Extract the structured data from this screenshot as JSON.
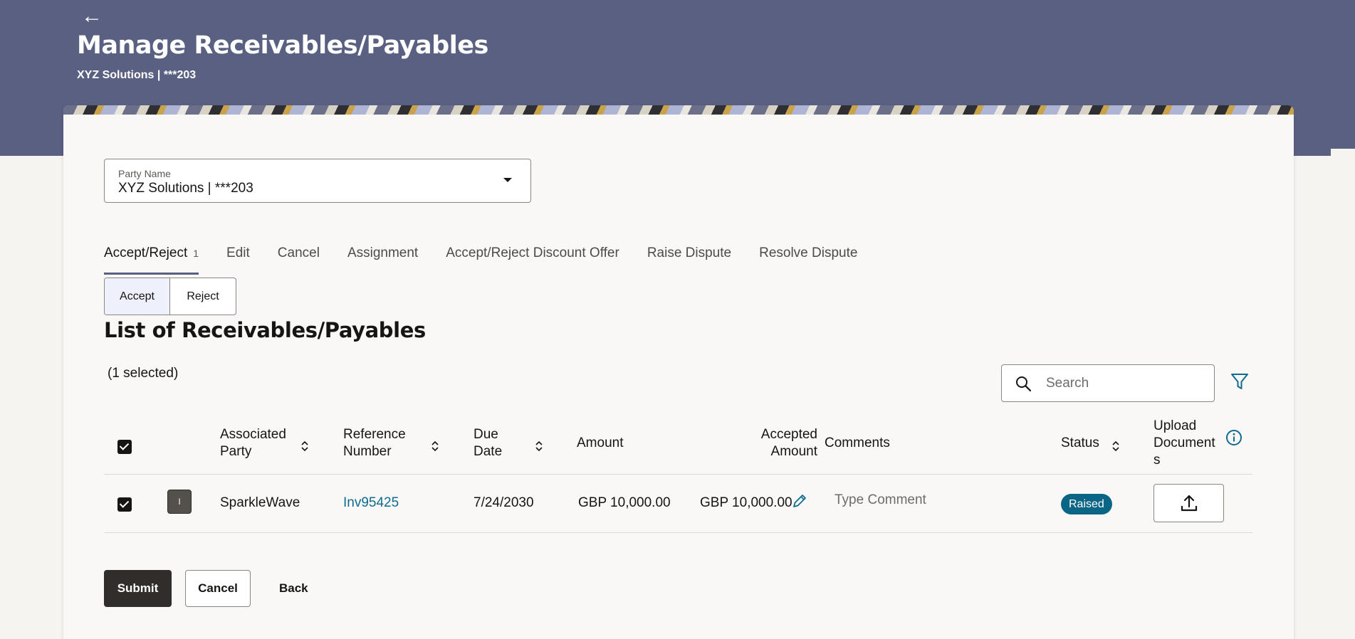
{
  "header": {
    "back_icon": "back-arrow-icon",
    "title": "Manage Receivables/Payables",
    "subtitle": "XYZ Solutions | ***203",
    "band_color": "#5a6082"
  },
  "party_select": {
    "label": "Party Name",
    "value": "XYZ Solutions | ***203",
    "icon": "chevron-down-icon"
  },
  "tabs": [
    {
      "label": "Accept/Reject",
      "count": "1",
      "active": true
    },
    {
      "label": "Edit"
    },
    {
      "label": "Cancel"
    },
    {
      "label": "Assignment"
    },
    {
      "label": "Accept/Reject Discount Offer"
    },
    {
      "label": "Raise Dispute"
    },
    {
      "label": "Resolve Dispute"
    }
  ],
  "toggle": {
    "accept_label": "Accept",
    "reject_label": "Reject",
    "selected": "Accept"
  },
  "list": {
    "title": "List of Receivables/Payables",
    "selected_count": "(1 selected)",
    "search_placeholder": "Search",
    "search_icon": "search-icon",
    "filter_icon": "filter-icon"
  },
  "table": {
    "columns": {
      "associated_party": [
        "Associated",
        "Party"
      ],
      "reference_number": [
        "Reference",
        "Number"
      ],
      "due_date": [
        "Due",
        "Date"
      ],
      "amount": "Amount",
      "accepted_amount": [
        "Accepted",
        "Amount"
      ],
      "comments": "Comments",
      "status": "Status",
      "upload_documents": [
        "Upload",
        "Document",
        "s"
      ]
    },
    "rows": [
      {
        "checked": true,
        "avatar": "I",
        "associated_party": "SparkleWave",
        "reference_number": "Inv95425",
        "due_date": "7/24/2030",
        "amount": "GBP 10,000.00",
        "accepted_amount": "GBP 10,000.00",
        "comment_placeholder": "Type Comment",
        "status": "Raised",
        "status_color": "#0b6584"
      }
    ]
  },
  "actions": {
    "submit": "Submit",
    "cancel": "Cancel",
    "back": "Back"
  }
}
